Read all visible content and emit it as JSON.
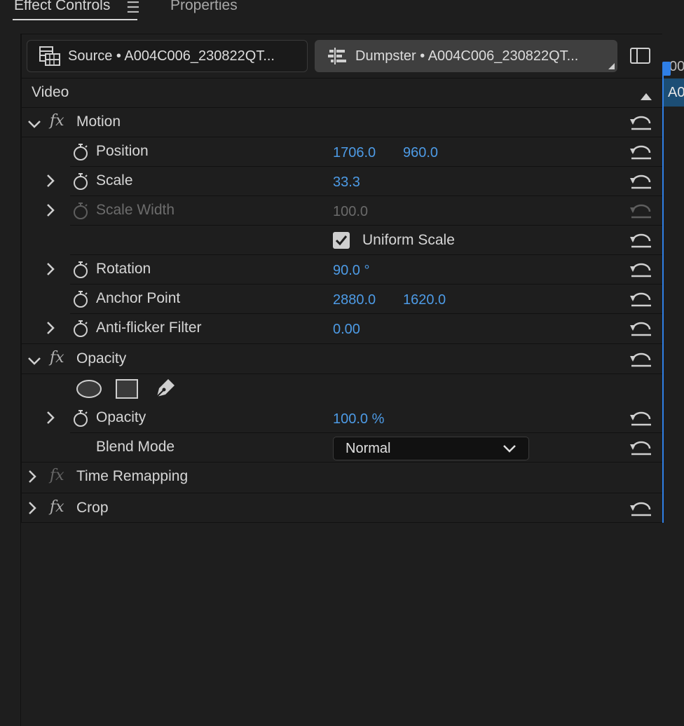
{
  "tabs": {
    "active": "Effect Controls",
    "menu_glyph": "☰",
    "other": "Properties"
  },
  "clips": {
    "source_label": "Source • A004C006_230822QT...",
    "sequence_label": "Dumpster • A004C006_230822QT..."
  },
  "timeline": {
    "timecode_fragment": "00",
    "clip_fragment": "A0"
  },
  "section": {
    "label": "Video"
  },
  "effects": {
    "motion": {
      "name": "Motion",
      "position": {
        "label": "Position",
        "x": "1706.0",
        "y": "960.0"
      },
      "scale": {
        "label": "Scale",
        "value": "33.3"
      },
      "scale_width": {
        "label": "Scale Width",
        "value": "100.0"
      },
      "uniform_scale": {
        "label": "Uniform Scale",
        "checked": true
      },
      "rotation": {
        "label": "Rotation",
        "value": "90.0 °"
      },
      "anchor_point": {
        "label": "Anchor Point",
        "x": "2880.0",
        "y": "1620.0"
      },
      "anti_flicker": {
        "label": "Anti-flicker Filter",
        "value": "0.00"
      }
    },
    "opacity": {
      "name": "Opacity",
      "opacity": {
        "label": "Opacity",
        "value": "100.0 %"
      },
      "blend_mode": {
        "label": "Blend Mode",
        "value": "Normal"
      }
    },
    "time_remapping": {
      "name": "Time Remapping"
    },
    "crop": {
      "name": "Crop"
    }
  },
  "icons": {
    "reset": "reset-icon",
    "stopwatch": "stopwatch-icon",
    "fx": "fx-badge",
    "fx_glyph": "fx"
  },
  "colors": {
    "value_blue": "#4d9be6",
    "playhead": "#2f7fe6",
    "clip_bar": "#1c4e75"
  }
}
